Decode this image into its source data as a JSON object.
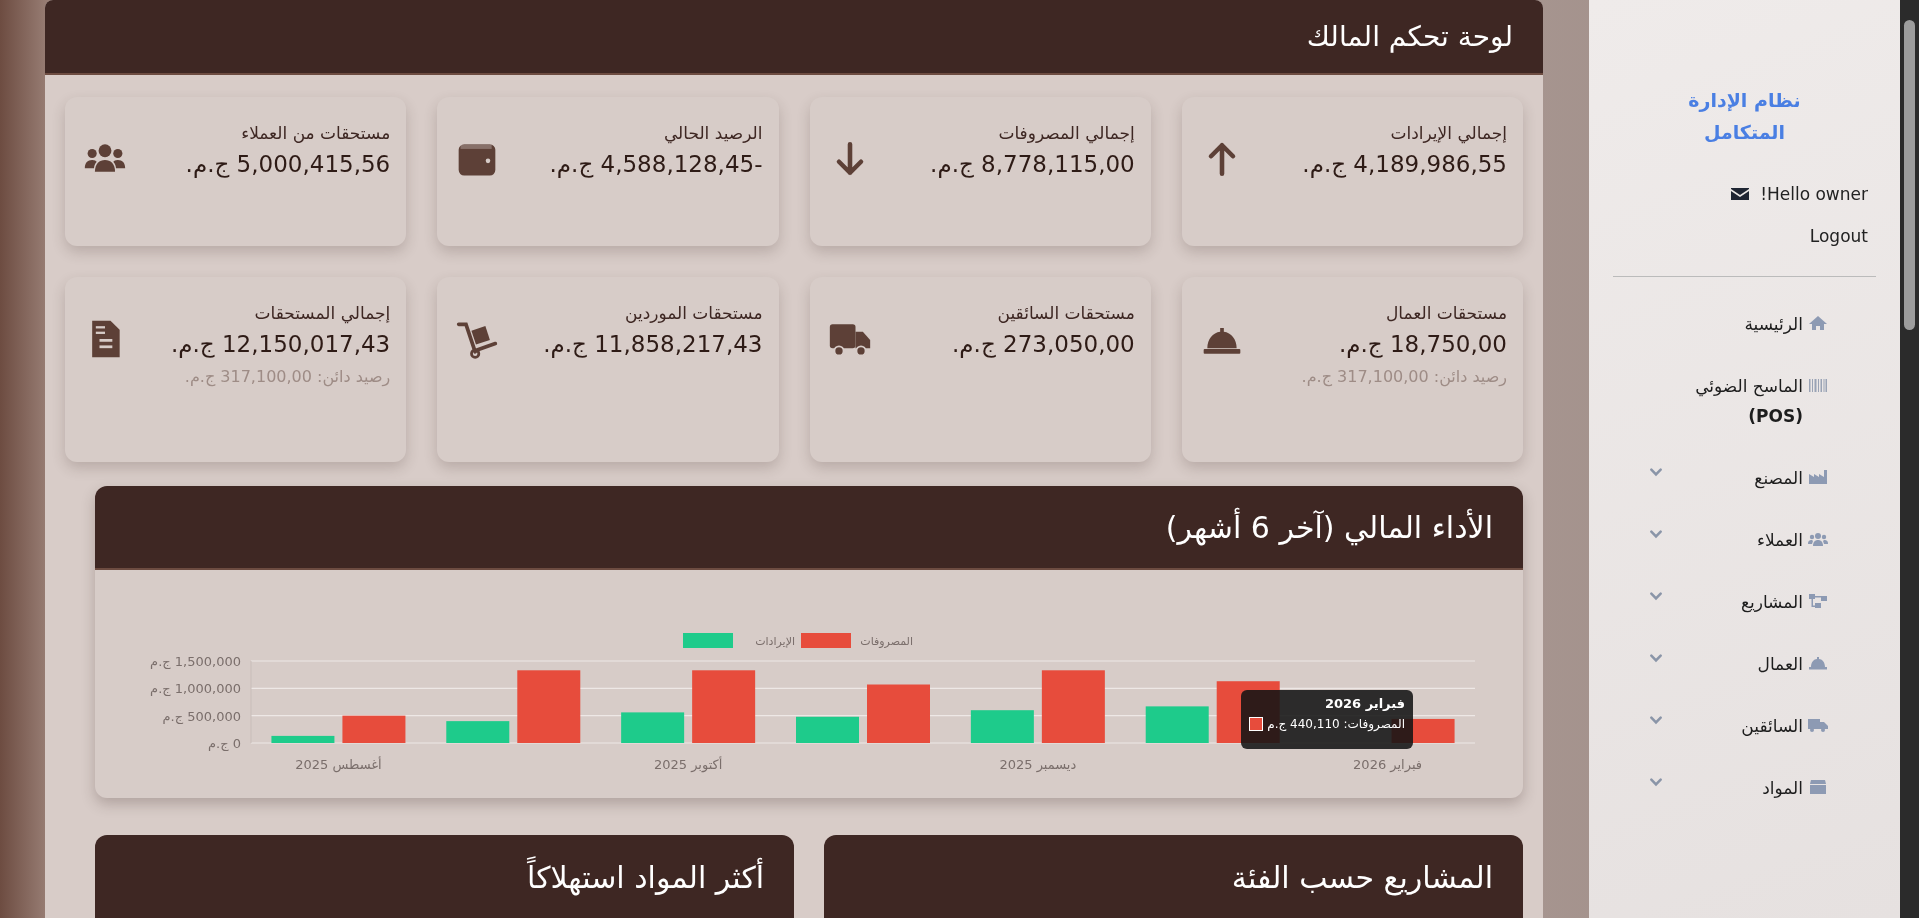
{
  "page": {
    "title": "لوحة تحكم المالك"
  },
  "cards": [
    {
      "title": "إجمالي الإيرادات",
      "amount": "4,189,986,55 ج.م."
    },
    {
      "title": "إجمالي المصروفات",
      "amount": "8,778,115,00 ج.م."
    },
    {
      "title": "الرصيد الحالي",
      "amount": "-4,588,128,45 ج.م."
    },
    {
      "title": "مستحقات من العملاء",
      "amount": "5,000,415,56 ج.م."
    },
    {
      "title": "مستحقات العمال",
      "amount": "18,750,00 ج.م.",
      "note": "رصيد دائن: 317,100,00 ج.م."
    },
    {
      "title": "مستحقات السائقين",
      "amount": "273,050,00 ج.م."
    },
    {
      "title": "مستحقات الموردين",
      "amount": "11,858,217,43 ج.م."
    },
    {
      "title": "إجمالي المستحقات",
      "amount": "12,150,017,43 ج.م.",
      "note": "رصيد دائن: 317,100,00 ج.م."
    }
  ],
  "performance": {
    "title": "الأداء المالي (آخر 6 أشهر)",
    "chart_data": {
      "type": "bar",
      "categories": [
        "أغسطس 2025",
        null,
        "أكتوبر 2025",
        null,
        "ديسمبر 2025",
        null,
        "فبراير 2026"
      ],
      "series": [
        {
          "name": "الإيرادات",
          "color": "#1ecb8b",
          "values": [
            130000,
            400000,
            560000,
            480000,
            600000,
            670000,
            null
          ]
        },
        {
          "name": "المصروفات",
          "color": "#e74c3c",
          "values": [
            500000,
            1330000,
            1330000,
            1070000,
            1330000,
            1130000,
            440110
          ]
        }
      ],
      "ylim": [
        0,
        1500000
      ],
      "legend": true,
      "yticks": [
        {
          "value": 0,
          "label": "0 ج.م"
        },
        {
          "value": 500000,
          "label": "500,000 ج.م"
        },
        {
          "value": 1000000,
          "label": "1,000,000 ج.م"
        },
        {
          "value": 1500000,
          "label": "1,500,000 ج.م"
        }
      ]
    },
    "tooltip": {
      "title": "فبراير 2026",
      "text": "المصروفات: 440,110 ج.م",
      "color": "#e74c3c"
    }
  },
  "panels": [
    {
      "title": "المشاريع حسب الفئة"
    },
    {
      "title": "أكثر المواد استهلاكاً"
    }
  ],
  "sidebar": {
    "brand": "نظام الإدارة المتكامل",
    "greeting": "Hello owner!",
    "logout": "Logout",
    "items": [
      {
        "label": "الرئيسية",
        "kind": "link"
      },
      {
        "label": "الماسح الضوئي **(POS)**",
        "kind": "link"
      },
      {
        "label": "المصنع",
        "kind": "group",
        "expanded": false
      },
      {
        "label": "العملاء",
        "kind": "group",
        "expanded": false
      },
      {
        "label": "المشاريع",
        "kind": "group",
        "expanded": false
      },
      {
        "label": "العمال",
        "kind": "group",
        "expanded": false
      },
      {
        "label": "السائقين",
        "kind": "group",
        "expanded": false
      },
      {
        "label": "المواد",
        "kind": "group",
        "expanded": false
      }
    ]
  }
}
